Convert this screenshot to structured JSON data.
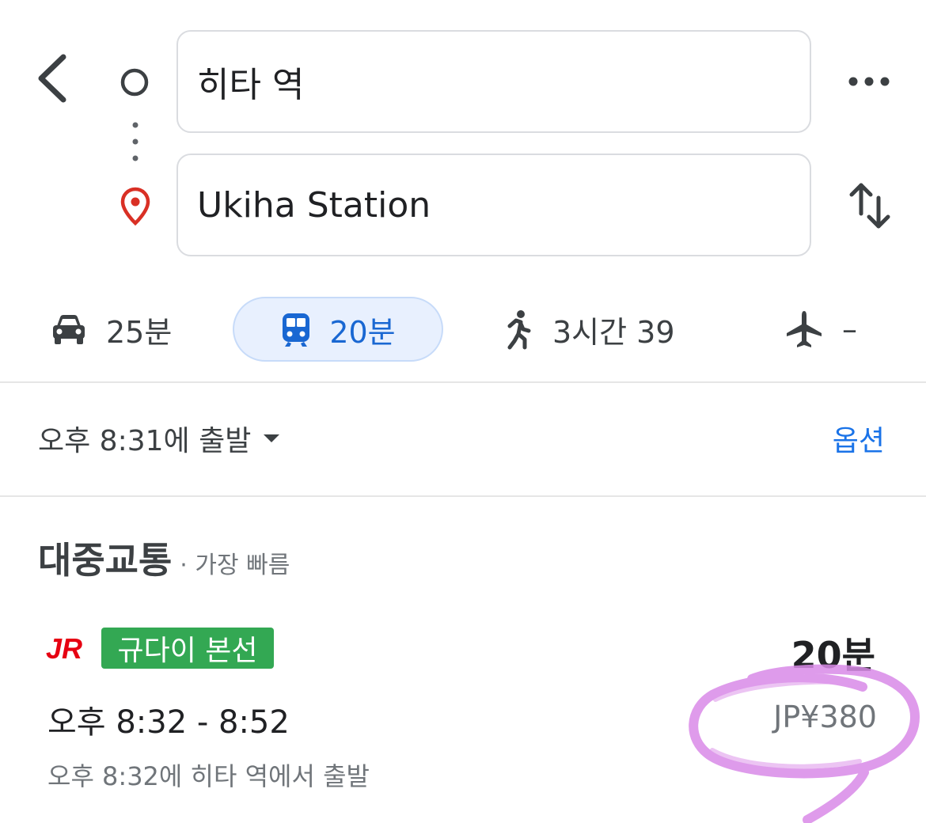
{
  "search": {
    "origin": "히타 역",
    "destination": "Ukiha Station"
  },
  "modes": [
    {
      "name": "drive",
      "icon": "car-icon",
      "label": "25분"
    },
    {
      "name": "transit",
      "icon": "train-icon",
      "label": "20분",
      "selected": true
    },
    {
      "name": "walk",
      "icon": "walking-icon",
      "label": "3시간 39"
    },
    {
      "name": "flight",
      "icon": "airplane-icon",
      "label": "–"
    }
  ],
  "departure": {
    "label": "오후 8:31에 출발",
    "options_label": "옵션"
  },
  "section": {
    "title": "대중교통",
    "subtitle": "· 가장 빠름"
  },
  "route": {
    "operator_logo": "JR",
    "line_name": "규다이 본선",
    "line_color": "#33a853",
    "duration": "20분",
    "times": "오후 8:32 - 8:52",
    "fare": "JP¥380",
    "departure_note": "오후 8:32에 히타 역에서 출발"
  },
  "colors": {
    "accent": "#1a73e8",
    "transit_highlight": "#e8f0fe",
    "pin": "#d93025",
    "jr_red": "#e60012",
    "annotation": "#d98ae8"
  }
}
